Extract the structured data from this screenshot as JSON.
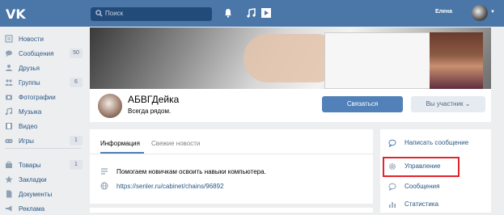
{
  "header": {
    "logo": "VK",
    "search_placeholder": "Поиск",
    "username": "Елена"
  },
  "sidebar": {
    "items": [
      {
        "label": "Новости",
        "count": ""
      },
      {
        "label": "Сообщения",
        "count": "50"
      },
      {
        "label": "Друзья",
        "count": ""
      },
      {
        "label": "Группы",
        "count": "6"
      },
      {
        "label": "Фотографии",
        "count": ""
      },
      {
        "label": "Музыка",
        "count": ""
      },
      {
        "label": "Видео",
        "count": ""
      },
      {
        "label": "Игры",
        "count": "1"
      },
      {
        "label": "Товары",
        "count": "1"
      },
      {
        "label": "Закладки",
        "count": ""
      },
      {
        "label": "Документы",
        "count": ""
      },
      {
        "label": "Реклама",
        "count": ""
      }
    ]
  },
  "group": {
    "name": "АБВГДейка",
    "status": "Всегда рядом.",
    "join_button": "Связаться",
    "member_button": "Вы участник"
  },
  "info": {
    "tabs": [
      "Информация",
      "Свежие новости"
    ],
    "description": "Помогаем новичкам освоить навыки компьютера.",
    "link": "https://senler.ru/cabinet/chains/96892"
  },
  "actions": {
    "items": [
      {
        "label": "Написать сообщение"
      },
      {
        "label": "Управление"
      },
      {
        "label": "Сообщения"
      },
      {
        "label": "Статистика"
      }
    ]
  },
  "colors": {
    "header": "#4a76a8",
    "accent": "#5181b8",
    "highlight": "#e0262d"
  }
}
